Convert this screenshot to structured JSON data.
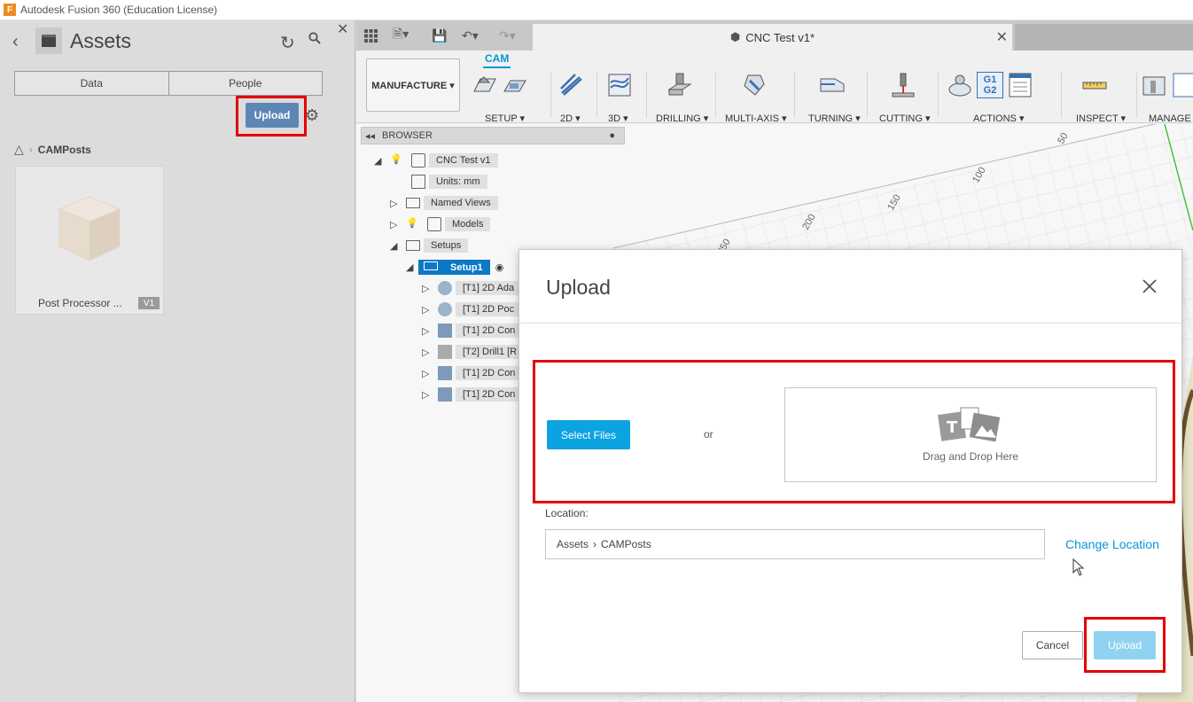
{
  "window": {
    "title": "Autodesk Fusion 360 (Education License)",
    "app_icon": "F"
  },
  "data_panel": {
    "title": "Assets",
    "tabs": [
      "Data",
      "People"
    ],
    "upload_label": "Upload",
    "breadcrumb": "CAMPosts",
    "file": {
      "name": "Post Processor ...",
      "version": "V1"
    }
  },
  "document_tab": {
    "title": "CNC Test v1*"
  },
  "toolbar": {
    "workspace": "MANUFACTURE ▾",
    "active_tab": "CAM",
    "groups": [
      {
        "label": "SETUP ▾"
      },
      {
        "label": "2D ▾"
      },
      {
        "label": "3D ▾"
      },
      {
        "label": "DRILLING ▾"
      },
      {
        "label": "MULTI-AXIS ▾"
      },
      {
        "label": "TURNING ▾"
      },
      {
        "label": "CUTTING ▾"
      },
      {
        "label": "ACTIONS ▾"
      },
      {
        "label": "INSPECT ▾"
      },
      {
        "label": "MANAGE ▾"
      }
    ],
    "gcode_icon_text": [
      "G1",
      "G2"
    ]
  },
  "browser": {
    "header": "BROWSER",
    "items": [
      {
        "label": "CNC Test v1"
      },
      {
        "label": "Units: mm"
      },
      {
        "label": "Named Views"
      },
      {
        "label": "Models"
      },
      {
        "label": "Setups"
      },
      {
        "label": "Setup1"
      },
      {
        "label": "[T1] 2D Ada"
      },
      {
        "label": "[T1] 2D Poc"
      },
      {
        "label": "[T1] 2D Con"
      },
      {
        "label": "[T2] Drill1 [R"
      },
      {
        "label": "[T1] 2D Con"
      },
      {
        "label": "[T1] 2D Con"
      }
    ]
  },
  "ruler_ticks": [
    "50",
    "100",
    "150",
    "200",
    "250"
  ],
  "dialog": {
    "title": "Upload",
    "select_files": "Select Files",
    "or": "or",
    "drop_here": "Drag and Drop Here",
    "location_label": "Location:",
    "location_path": [
      "Assets",
      "CAMPosts"
    ],
    "change_location": "Change Location",
    "cancel": "Cancel",
    "upload": "Upload"
  }
}
